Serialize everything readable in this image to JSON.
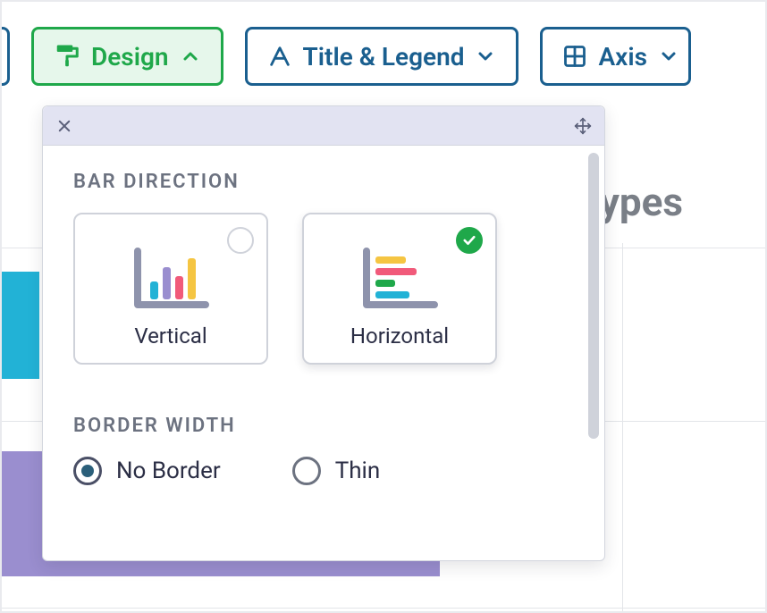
{
  "toolbar": {
    "design_label": "Design",
    "title_legend_label": "Title & Legend",
    "axis_label": "Axis"
  },
  "background": {
    "chart_title": "Payment types"
  },
  "panel": {
    "section_direction_label": "BAR DIRECTION",
    "direction": {
      "vertical_label": "Vertical",
      "horizontal_label": "Horizontal",
      "selected": "horizontal"
    },
    "section_border_label": "BORDER WIDTH",
    "border": {
      "none_label": "No Border",
      "thin_label": "Thin",
      "selected": "none"
    }
  }
}
